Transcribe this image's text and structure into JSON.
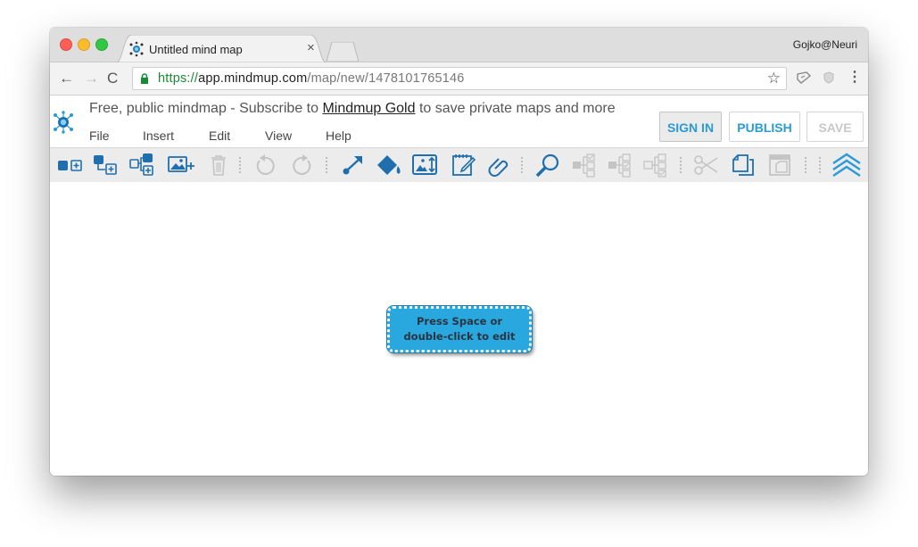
{
  "browser": {
    "tab_title": "Untitled mind map",
    "tab_close": "×",
    "profile": "Gojko@Neuri",
    "url_scheme": "https://",
    "url_host": "app.mindmup.com",
    "url_path": "/map/new/1478101765146",
    "nav": {
      "back": "←",
      "forward": "→",
      "reload": "C"
    },
    "star": "☆",
    "menu_dots": "⋮",
    "icons": [
      "lock-icon",
      "star-icon",
      "extension-icon",
      "shield-icon",
      "kebab-menu-icon"
    ]
  },
  "app": {
    "promo_before": "Free, public mindmap - Subscribe to ",
    "promo_link": "Mindmup Gold",
    "promo_after": " to save private maps and more",
    "menu": {
      "file": "File",
      "insert": "Insert",
      "edit": "Edit",
      "view": "View",
      "help": "Help"
    },
    "buttons": {
      "sign_in": "SIGN IN",
      "publish": "PUBLISH",
      "save": "SAVE"
    },
    "toolbar": [
      {
        "name": "add-child-icon",
        "enabled": true
      },
      {
        "name": "add-sibling-icon",
        "enabled": true
      },
      {
        "name": "add-parent-icon",
        "enabled": true
      },
      {
        "name": "add-image-icon",
        "enabled": true
      },
      {
        "name": "delete-icon",
        "enabled": false
      },
      {
        "name": "undo-icon",
        "enabled": false
      },
      {
        "name": "redo-icon",
        "enabled": false
      },
      {
        "name": "connector-icon",
        "enabled": true
      },
      {
        "name": "paint-bucket-icon",
        "enabled": true
      },
      {
        "name": "image-resize-icon",
        "enabled": true
      },
      {
        "name": "notes-icon",
        "enabled": true
      },
      {
        "name": "link-icon",
        "enabled": true
      },
      {
        "name": "search-icon",
        "enabled": true
      },
      {
        "name": "collapse-icon",
        "enabled": false
      },
      {
        "name": "toggle-collapse-icon",
        "enabled": false
      },
      {
        "name": "expand-icon",
        "enabled": false
      },
      {
        "name": "cut-icon",
        "enabled": false
      },
      {
        "name": "copy-icon",
        "enabled": true
      },
      {
        "name": "paste-icon",
        "enabled": false
      },
      {
        "name": "hide-toolbar-icon",
        "enabled": true
      }
    ],
    "colors": {
      "accent": "#2a9bd8",
      "node_fill": "#29a8e0",
      "disabled": "#c4c4c4"
    }
  },
  "canvas": {
    "node_text": "Press Space or double-click to edit"
  }
}
